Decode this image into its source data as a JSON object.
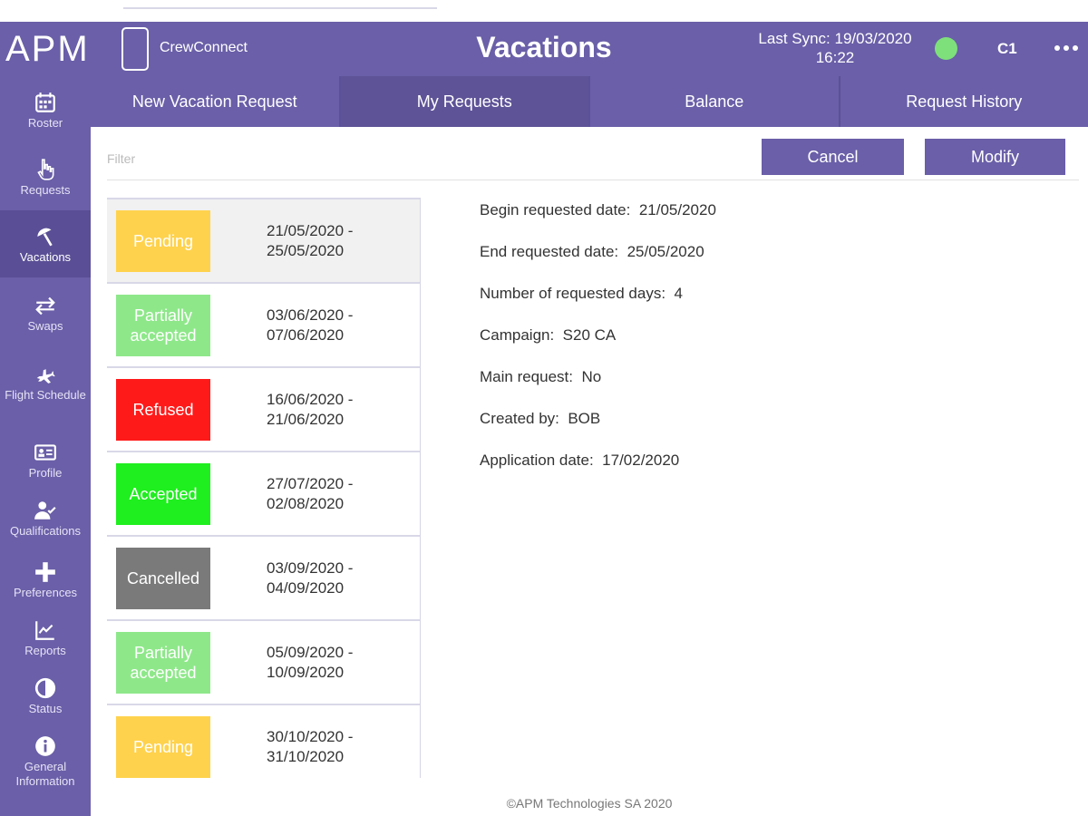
{
  "header": {
    "logo": "APM",
    "app_name": "CrewConnect",
    "title": "Vacations",
    "sync_line1": "Last Sync: 19/03/2020",
    "sync_line2": "16:22",
    "sync_status_color": "#7ee07a",
    "user": "C1",
    "more_icon": "ellipsis-icon"
  },
  "sidebar": {
    "items": [
      {
        "label": "Roster",
        "icon": "calendar-icon"
      },
      {
        "label": "Requests",
        "icon": "hand-pointer-icon"
      },
      {
        "label": "Vacations",
        "icon": "beach-umbrella-icon"
      },
      {
        "label": "Swaps",
        "icon": "swap-arrows-icon"
      },
      {
        "label": "Flight Schedule",
        "icon": "airplane-icon"
      },
      {
        "label": "Profile",
        "icon": "id-card-icon"
      },
      {
        "label": "Qualifications",
        "icon": "user-check-icon"
      },
      {
        "label": "Preferences",
        "icon": "plus-icon"
      },
      {
        "label": "Reports",
        "icon": "chart-icon"
      },
      {
        "label": "Status",
        "icon": "half-circle-icon"
      },
      {
        "label": "General Information",
        "icon": "info-icon"
      }
    ]
  },
  "tabs": [
    {
      "label": "New Vacation Request"
    },
    {
      "label": "My Requests"
    },
    {
      "label": "Balance"
    },
    {
      "label": "Request History"
    }
  ],
  "filter": {
    "placeholder": "Filter"
  },
  "actions": {
    "cancel": "Cancel",
    "modify": "Modify"
  },
  "requests": [
    {
      "status": "Pending",
      "color": "#ffd24d",
      "start": "21/05/2020 -",
      "end": "25/05/2020"
    },
    {
      "status": "Partially accepted",
      "color": "#8ee88a",
      "start": "03/06/2020 -",
      "end": "07/06/2020"
    },
    {
      "status": "Refused",
      "color": "#ff1a1a",
      "start": "16/06/2020 -",
      "end": "21/06/2020"
    },
    {
      "status": "Accepted",
      "color": "#1fee1f",
      "start": "27/07/2020 -",
      "end": "02/08/2020"
    },
    {
      "status": "Cancelled",
      "color": "#7a7a7a",
      "start": "03/09/2020 -",
      "end": "04/09/2020"
    },
    {
      "status": "Partially accepted",
      "color": "#8ee88a",
      "start": "05/09/2020 -",
      "end": "10/09/2020"
    },
    {
      "status": "Pending",
      "color": "#ffd24d",
      "start": "30/10/2020 -",
      "end": "31/10/2020"
    }
  ],
  "details": [
    {
      "label": "Begin requested date:",
      "value": "21/05/2020"
    },
    {
      "label": "End requested date:",
      "value": "25/05/2020"
    },
    {
      "label": "Number of requested days:",
      "value": "4"
    },
    {
      "label": "Campaign:",
      "value": "S20 CA"
    },
    {
      "label": "Main request:",
      "value": "No"
    },
    {
      "label": "Created by:",
      "value": "BOB"
    },
    {
      "label": "Application date:",
      "value": "17/02/2020"
    }
  ],
  "footer": "©APM Technologies SA 2020"
}
